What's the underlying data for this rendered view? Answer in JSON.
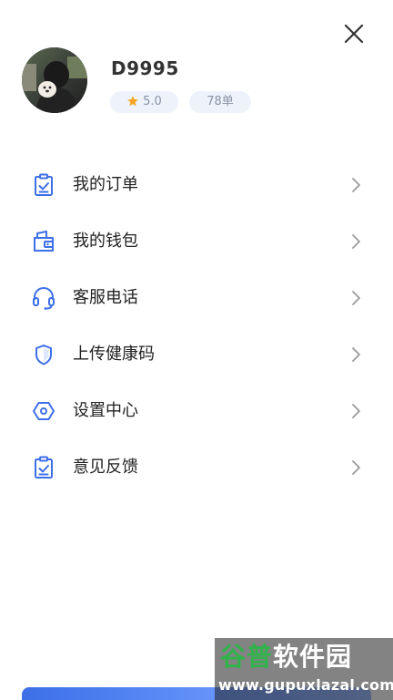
{
  "header": {
    "close_icon": "close-icon"
  },
  "profile": {
    "username": "D9995",
    "rating": "5.0",
    "rating_icon": "star-icon",
    "orders": "78单",
    "accent_star_color": "#f5a623",
    "badge_bg": "#edf2fb"
  },
  "menu": {
    "items": [
      {
        "label": "我的订单",
        "icon": "order-clipboard-icon"
      },
      {
        "label": "我的钱包",
        "icon": "wallet-icon"
      },
      {
        "label": "客服电话",
        "icon": "headset-icon"
      },
      {
        "label": "上传健康码",
        "icon": "shield-icon"
      },
      {
        "label": "设置中心",
        "icon": "settings-hexagon-icon"
      },
      {
        "label": "意见反馈",
        "icon": "feedback-clipboard-icon"
      }
    ],
    "icon_color": "#3d6fe8",
    "chevron_color": "#9a9a9a"
  },
  "watermark": {
    "title_part1": "谷普",
    "title_part2": "软件园",
    "url": "www.gupuxlazal.com"
  }
}
